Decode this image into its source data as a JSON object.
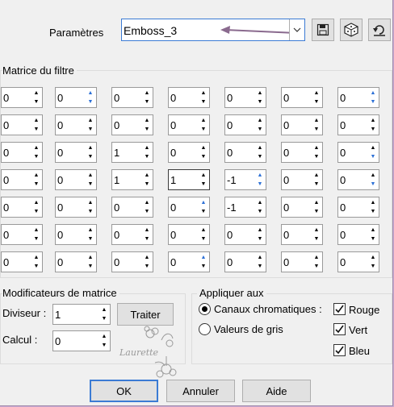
{
  "header": {
    "params_label": "Paramètres",
    "preset_value": "Emboss_3"
  },
  "matrix": {
    "title": "Matrice du filtre",
    "rows": [
      [
        "0",
        "0",
        "0",
        "0",
        "0",
        "0",
        "0"
      ],
      [
        "0",
        "0",
        "0",
        "0",
        "0",
        "0",
        "0"
      ],
      [
        "0",
        "0",
        "1",
        "0",
        "0",
        "0",
        "0"
      ],
      [
        "0",
        "0",
        "1",
        "1",
        "-1",
        "0",
        "0"
      ],
      [
        "0",
        "0",
        "0",
        "0",
        "-1",
        "0",
        "0"
      ],
      [
        "0",
        "0",
        "0",
        "0",
        "0",
        "0",
        "0"
      ],
      [
        "0",
        "0",
        "0",
        "0",
        "0",
        "0",
        "0"
      ]
    ]
  },
  "modifiers": {
    "title": "Modificateurs de matrice",
    "divisor_label": "Diviseur :",
    "divisor_value": "1",
    "calc_label": "Calcul :",
    "calc_value": "0",
    "process_label": "Traiter"
  },
  "apply": {
    "title": "Appliquer aux",
    "chromatic_label": "Canaux chromatiques :",
    "grey_label": "Valeurs de gris",
    "red_label": "Rouge",
    "green_label": "Vert",
    "blue_label": "Bleu"
  },
  "watermark": "Laurette",
  "buttons": {
    "ok": "OK",
    "cancel": "Annuler",
    "help": "Aide"
  },
  "colors": {
    "accent": "#3b7bd4",
    "arrow": "#8a6a8e",
    "frame": "#c9a9d2"
  }
}
